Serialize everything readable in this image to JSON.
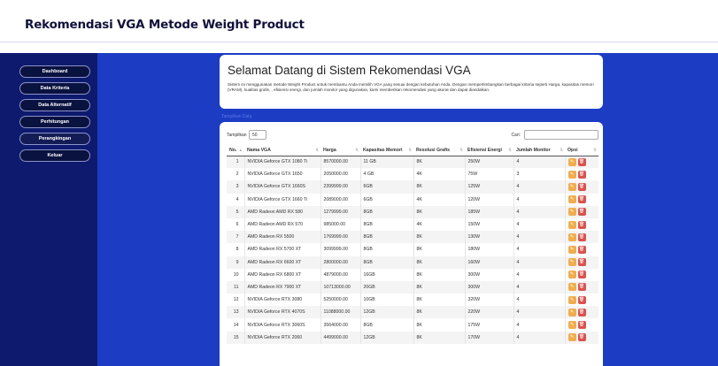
{
  "header": {
    "title": "Rekomendasi VGA Metode Weight Product"
  },
  "sidebar": {
    "items": [
      {
        "label": "Dashboard"
      },
      {
        "label": "Data Kriteria"
      },
      {
        "label": "Data Alternatif"
      },
      {
        "label": "Perhitungan"
      },
      {
        "label": "Perangkingan"
      },
      {
        "label": "Keluar"
      }
    ]
  },
  "welcome": {
    "title": "Selamat Datang di Sistem Rekomendasi VGA",
    "text": "Sistem ini menggunakan metode Weight Product untuk membantu Anda memilih VGA yang sesuai dengan kebutuhan Anda. Dengan mempertimbangkan berbagai kriteria seperti Harga, kapasitas memori (VRAM), kualitas grafis, , efisiensi energi, dan jumlah monitor yang digunakan, kami memberikan rekomendasi yang akurat dan dapat diandalkan."
  },
  "show_data_link": "Tampilkan Data",
  "controls": {
    "show_label": "Tampilkan",
    "show_value": "50",
    "search_label": "Cari:"
  },
  "table": {
    "headers": [
      "No.",
      "Nama VGA",
      "Harga",
      "Kapasitas Memori",
      "Resolusi Grafis",
      "Efisiensi Energi",
      "Jumlah Monitor",
      "Opsi"
    ],
    "rows": [
      [
        "1",
        "NVIDIA Geforce GTX 1080 Ti",
        "8570000.00",
        "11 GB",
        "8K",
        "250W",
        "4"
      ],
      [
        "2",
        "NVIDIA Geforce GTX 1650",
        "2050000.00",
        "4 GB",
        "4K",
        "75W",
        "3"
      ],
      [
        "3",
        "NVIDIA Geforce GTX 1660S",
        "2399999.00",
        "6GB",
        "8K",
        "125W",
        "4"
      ],
      [
        "4",
        "NVIDIA Geforce GTX 1660 Ti",
        "2089000.00",
        "6GB",
        "4K",
        "120W",
        "4"
      ],
      [
        "5",
        "AMD Radeon AMD RX 580",
        "1279999.00",
        "8GB",
        "8K",
        "185W",
        "4"
      ],
      [
        "6",
        "AMD Radeon AMD RX 570",
        "985000.00",
        "8GB",
        "4K",
        "150W",
        "4"
      ],
      [
        "7",
        "AMD Radeon RX 5500",
        "1769999.00",
        "8GB",
        "8K",
        "130W",
        "4"
      ],
      [
        "8",
        "AMD Radeon RX 5700 XT",
        "3099999.00",
        "8GB",
        "8K",
        "180W",
        "4"
      ],
      [
        "9",
        "AMD Radeon RX 6600 XT",
        "2800000.00",
        "8GB",
        "8K",
        "160W",
        "4"
      ],
      [
        "10",
        "AMD Radeon RX 6800 XT",
        "4879000.00",
        "16GB",
        "8K",
        "300W",
        "4"
      ],
      [
        "11",
        "AMD Radeon RX 7900 XT",
        "10713000.00",
        "20GB",
        "8K",
        "300W",
        "4"
      ],
      [
        "12",
        "NVIDIA Geforce RTX 3080",
        "5250000.00",
        "10GB",
        "8K",
        "320W",
        "4"
      ],
      [
        "13",
        "NVIDIA Geforce RTX 4070S",
        "11088000.00",
        "12GB",
        "8K",
        "220W",
        "4"
      ],
      [
        "14",
        "NVIDIA Geforce RTX 3060S",
        "3564000.00",
        "8GB",
        "8K",
        "175W",
        "4"
      ],
      [
        "15",
        "NVIDIA Geforce RTX 2060",
        "4499000.00",
        "12GB",
        "8K",
        "170W",
        "4"
      ]
    ]
  },
  "colors": {
    "sidebar": "#0d1a6e",
    "main_bg": "#1c3cc4",
    "edit": "#f0ad4e",
    "delete": "#d9534f"
  },
  "icons": {
    "edit": "pencil-square-icon",
    "delete": "trash-icon"
  }
}
